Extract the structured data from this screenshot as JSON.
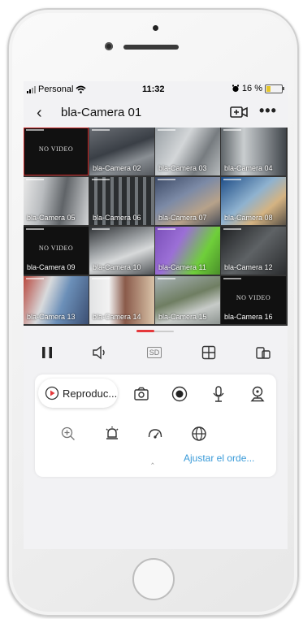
{
  "status": {
    "carrier": "Personal",
    "time": "11:32",
    "battery": "16 %"
  },
  "nav": {
    "title": "bla-Camera 01"
  },
  "cameras": [
    {
      "label": "",
      "novideo": "NO VIDEO",
      "selected": true
    },
    {
      "label": "bla-Camera 02"
    },
    {
      "label": "bla-Camera 03"
    },
    {
      "label": "bla-Camera 04"
    },
    {
      "label": "bla-Camera 05"
    },
    {
      "label": "bla-Camera 06"
    },
    {
      "label": "bla-Camera 07"
    },
    {
      "label": "bla-Camera 08"
    },
    {
      "label": "bla-Camera 09",
      "novideo": "NO VIDEO"
    },
    {
      "label": "bla-Camera 10"
    },
    {
      "label": "bla-Camera 11"
    },
    {
      "label": "bla-Camera 12"
    },
    {
      "label": "bla-Camera 13"
    },
    {
      "label": "bla-Camera 14"
    },
    {
      "label": "bla-Camera 15"
    },
    {
      "label": "bla-Camera 16",
      "novideo": "NO VIDEO"
    }
  ],
  "controls": {
    "sd_label": "SD"
  },
  "panel": {
    "playback_label": "Reproduc...",
    "reorder_label": "Ajustar el orde..."
  },
  "colors": {
    "accent": "#e5383b",
    "link": "#3a9bd9",
    "battery_fill": "#e4c52a"
  }
}
